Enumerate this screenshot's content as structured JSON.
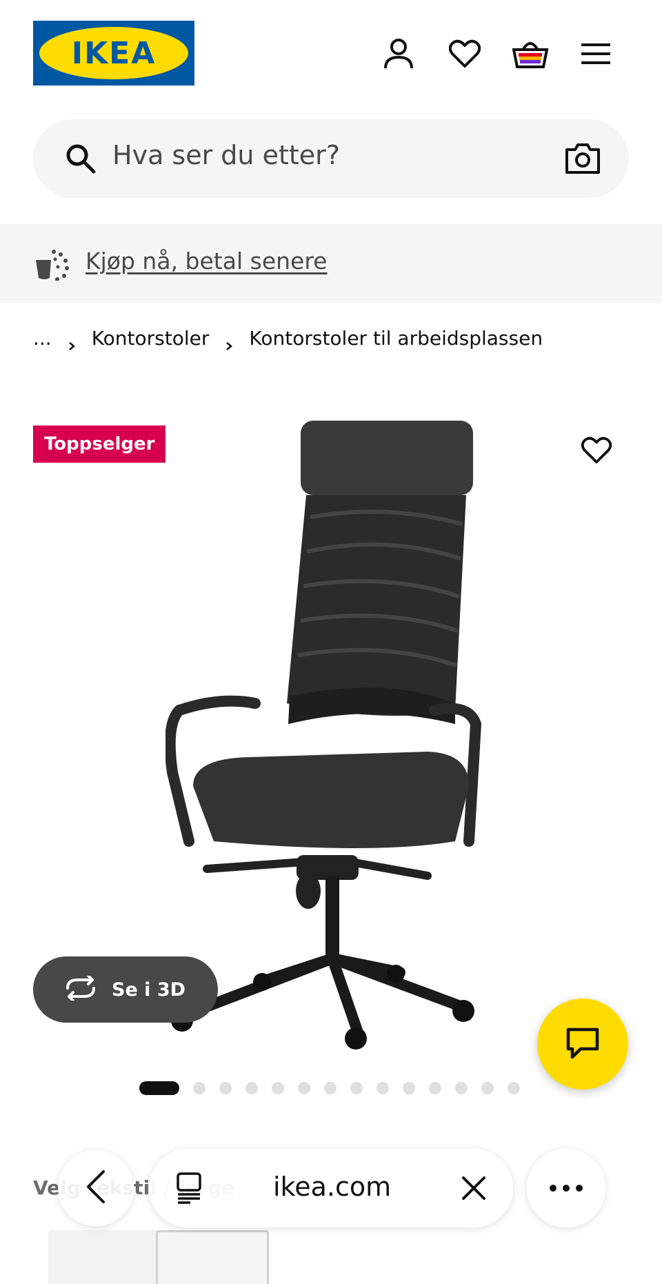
{
  "header": {
    "logo_text": "IKEA",
    "icons": [
      "user-icon",
      "heart-icon",
      "basket-icon",
      "menu-icon"
    ]
  },
  "search": {
    "placeholder": "Hva ser du etter?"
  },
  "promo": {
    "text": "Kjøp nå, betal senere"
  },
  "breadcrumb": {
    "items": [
      "...",
      "Kontorstoler",
      "Kontorstoler til arbeidsplassen"
    ]
  },
  "product": {
    "badge": "Toppselger",
    "view_3d_label": "Se i 3D",
    "image_count": 14,
    "active_image": 1
  },
  "below_fold": {
    "variant_label": "Velg tekstil / farge"
  },
  "browser": {
    "url": "ikea.com"
  },
  "colors": {
    "ikea_blue": "#0058a3",
    "ikea_yellow": "#ffdb00",
    "badge_red": "#d7004f",
    "button_dark": "#484848"
  }
}
